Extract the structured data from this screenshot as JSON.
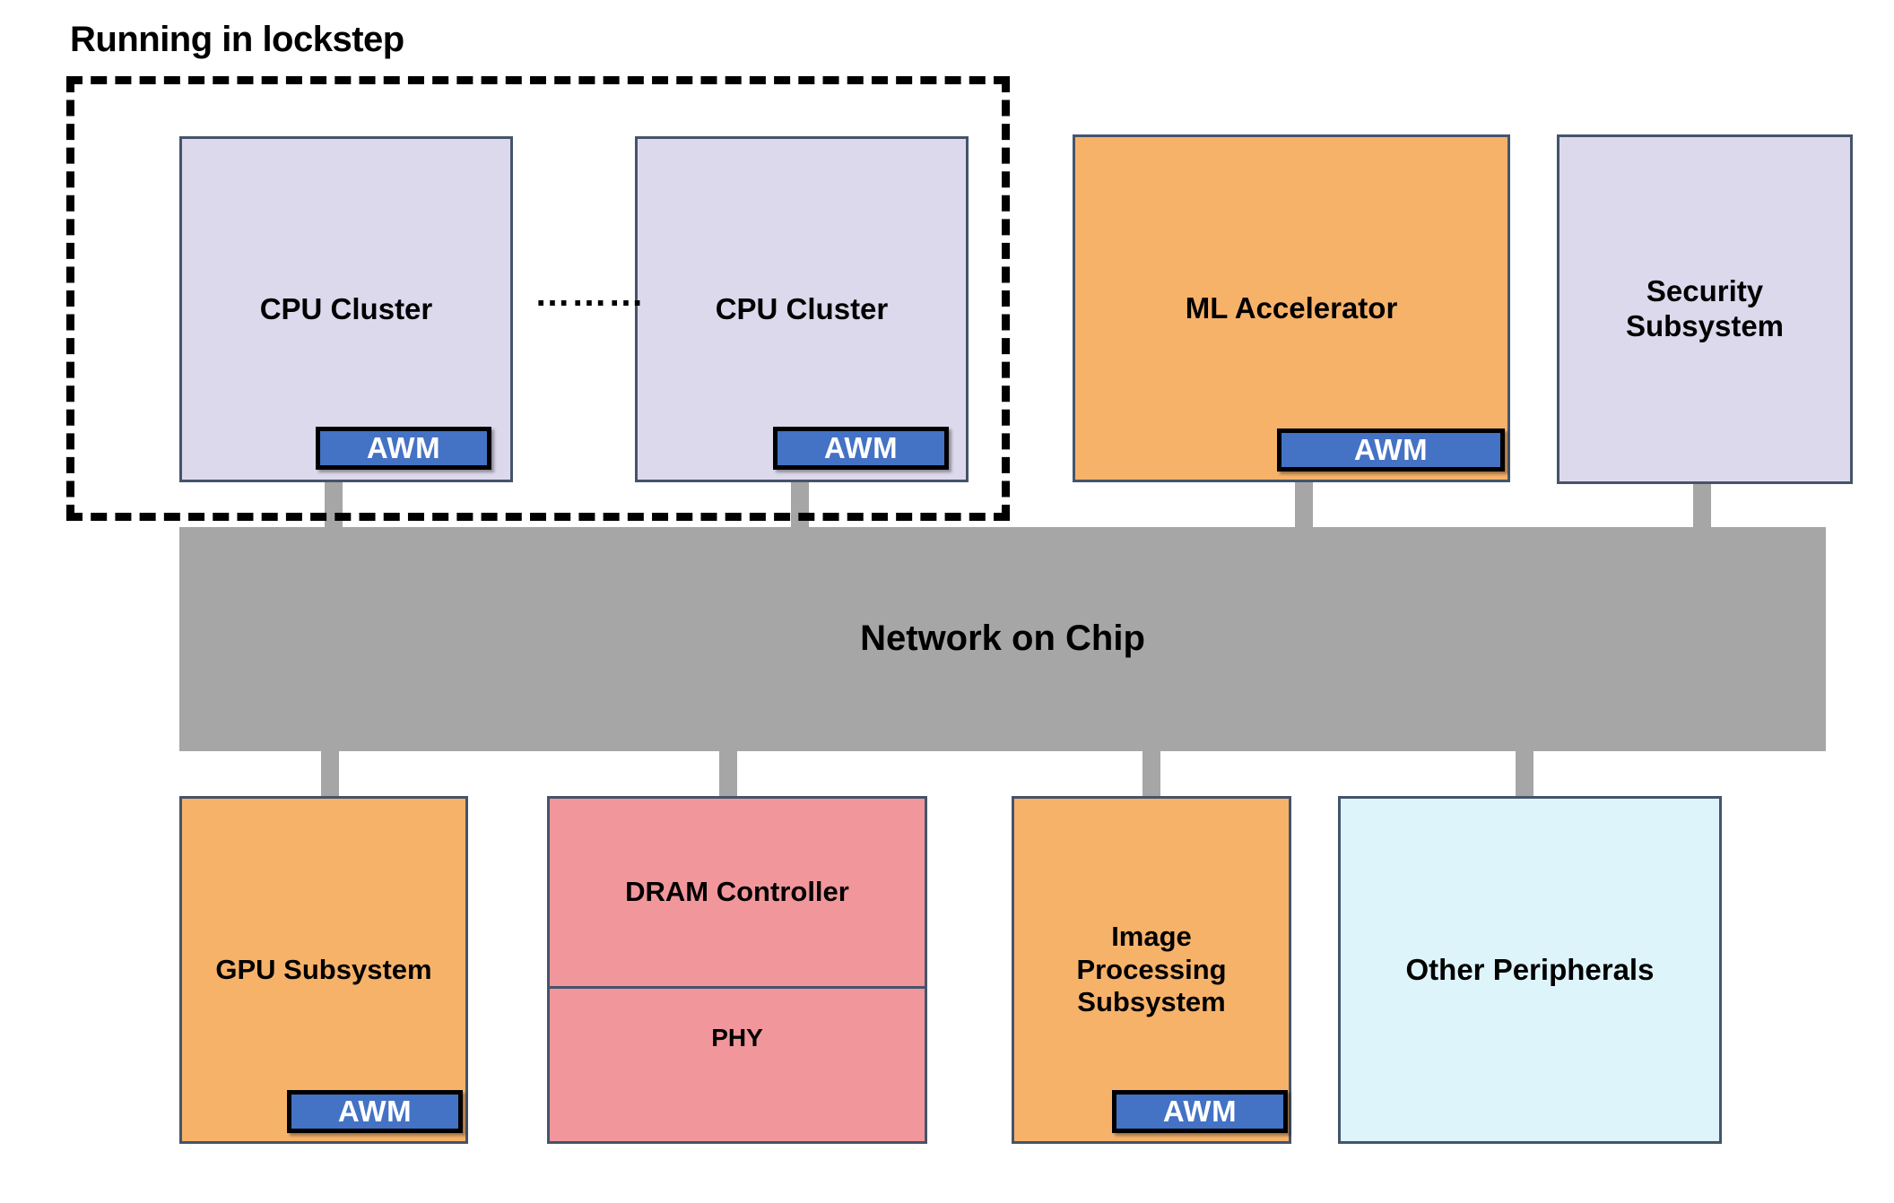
{
  "diagram": {
    "lockstep_group": {
      "label": "Running in lockstep"
    },
    "ellipsis": "………",
    "interconnect": {
      "label": "Network on Chip",
      "color": "#A6A6A6"
    },
    "top_row": [
      {
        "name": "cpu-cluster-1",
        "label": "CPU Cluster",
        "color": "#DDD9EC",
        "awm": "AWM"
      },
      {
        "name": "cpu-cluster-2",
        "label": "CPU Cluster",
        "color": "#DDD9EC",
        "awm": "AWM"
      },
      {
        "name": "ml-accelerator",
        "label": "ML Accelerator",
        "color": "#F7B26A",
        "awm": "AWM"
      },
      {
        "name": "security-subsystem",
        "label": "Security\nSubsystem",
        "color": "#DDD9EC",
        "awm": null
      }
    ],
    "bottom_row": [
      {
        "name": "gpu-subsystem",
        "label": "GPU Subsystem",
        "color": "#F7B26A",
        "awm": "AWM"
      },
      {
        "name": "dram-controller",
        "label": "DRAM Controller",
        "sublabel": "PHY",
        "color": "#F1969B",
        "awm": null
      },
      {
        "name": "image-processing-subsystem",
        "label": "Image\nProcessing\nSubsystem",
        "color": "#F7B26A",
        "awm": "AWM"
      },
      {
        "name": "other-peripherals",
        "label": "Other Peripherals",
        "color": "#DDF4FA",
        "awm": null
      }
    ],
    "colors": {
      "block_border": "#44546A",
      "lavender": "#DDD9EC",
      "orange": "#F7B26A",
      "pink": "#F1969B",
      "cyan": "#DDF4FA",
      "gray": "#A6A6A6",
      "awm_blue": "#4472C4",
      "awm_border": "#000000",
      "dashed_group": "#000000"
    }
  }
}
